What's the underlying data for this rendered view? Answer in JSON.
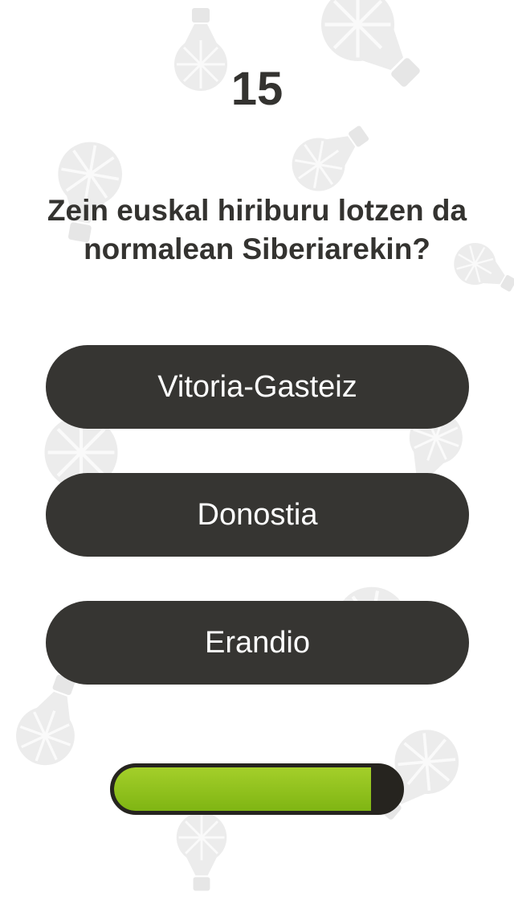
{
  "question_number": "15",
  "question": "Zein euskal hiriburu lotzen da normalean Siberiarekin?",
  "answers": [
    "Vitoria-Gasteiz",
    "Donostia",
    "Erandio"
  ],
  "timer": {
    "remaining_fraction": 0.9
  },
  "colors": {
    "background": "#ffffff",
    "text": "#343330",
    "button": "#363532",
    "button_text": "#ffffff",
    "timer_fill": "#94c41f",
    "timer_track": "#26241f",
    "bulb_watermark": "#ececec"
  },
  "background_icons": "lightbulb-icon"
}
